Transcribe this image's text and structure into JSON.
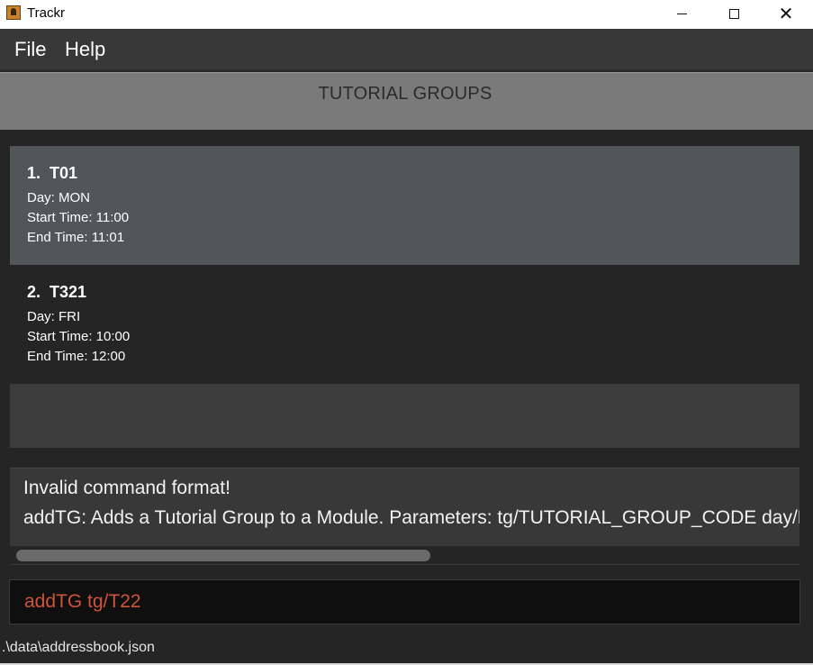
{
  "window": {
    "title": "Trackr",
    "controls": {
      "minimize": "minimize-icon",
      "maximize": "maximize-icon",
      "close": "✕"
    }
  },
  "menu": {
    "file": "File",
    "help": "Help"
  },
  "panel": {
    "title": "TUTORIAL GROUPS"
  },
  "groups": [
    {
      "index": "1.",
      "code": "T01",
      "day": "Day: MON",
      "start": "Start Time: 11:00",
      "end": "End Time: 11:01",
      "selected": true
    },
    {
      "index": "2.",
      "code": "T321",
      "day": "Day: FRI",
      "start": "Start Time: 10:00",
      "end": "End Time: 12:00",
      "selected": false
    }
  ],
  "result": {
    "line1": "Invalid command format!",
    "line2": "addTG: Adds a Tutorial Group to a Module. Parameters: tg/TUTORIAL_GROUP_CODE day/MON"
  },
  "command": {
    "value": "addTG tg/T22"
  },
  "status": {
    "path": ".\\data\\addressbook.json"
  },
  "colors": {
    "command_text": "#d0533d",
    "selected_card": "#515658",
    "header": "#7a7a7a"
  }
}
